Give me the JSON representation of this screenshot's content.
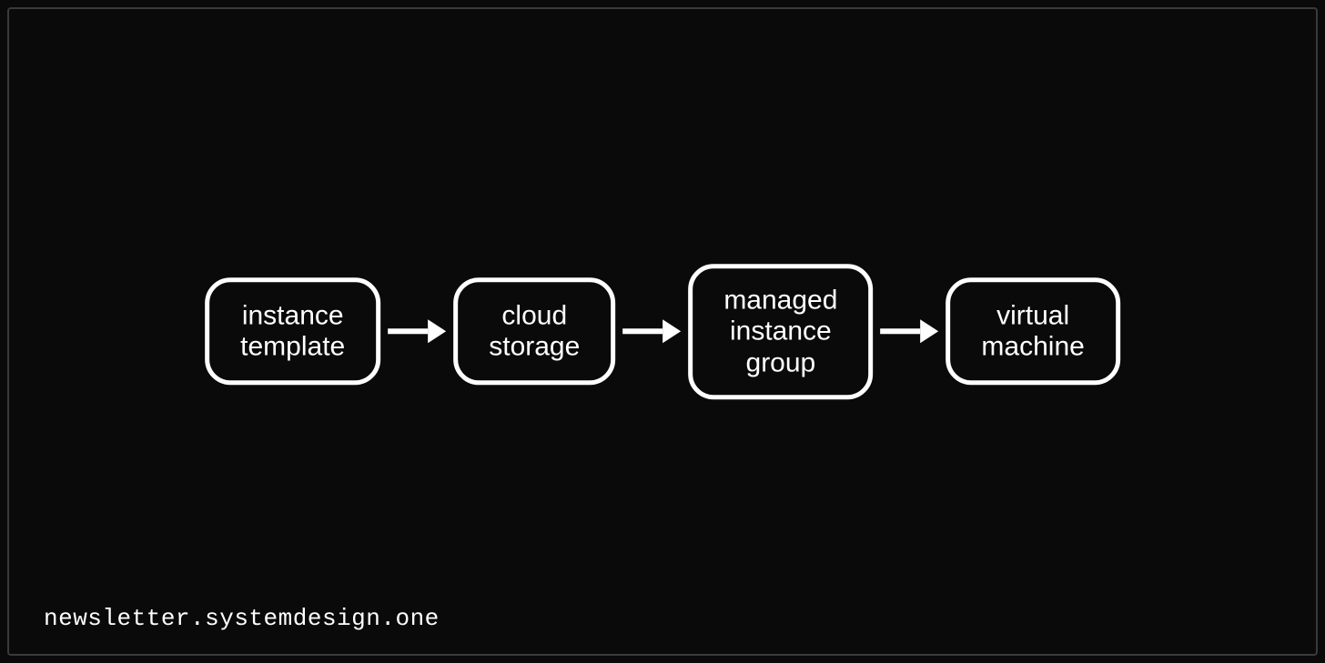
{
  "diagram": {
    "nodes": [
      {
        "label": "instance\ntemplate"
      },
      {
        "label": "cloud\nstorage"
      },
      {
        "label": "managed\ninstance\ngroup"
      },
      {
        "label": "virtual\nmachine"
      }
    ]
  },
  "attribution": "newsletter.systemdesign.one"
}
